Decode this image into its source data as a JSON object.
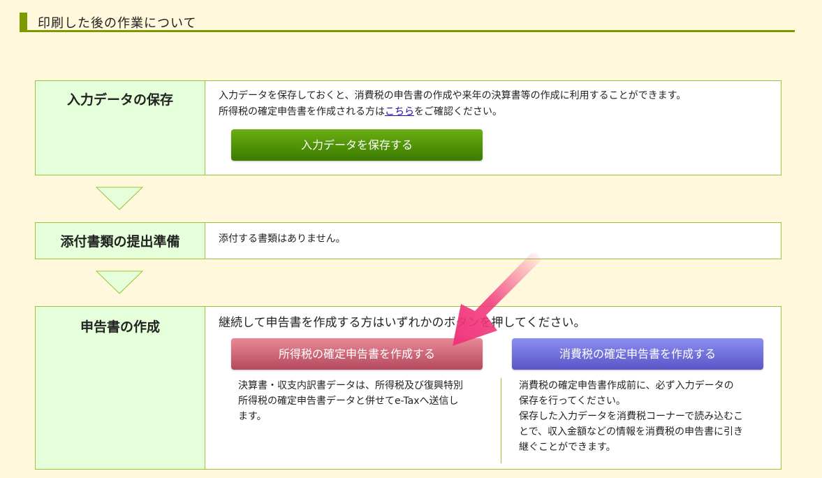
{
  "header": {
    "title": "印刷した後の作業について"
  },
  "step_save": {
    "label": "入力データの保存",
    "line1": "入力データを保存しておくと、消費税の申告書の作成や来年の決算書等の作成に利用することができます。",
    "line2_pre": "所得税の確定申告書を作成される方は",
    "line2_link": "こちら",
    "line2_post": "をご確認ください。",
    "button": "入力データを保存する"
  },
  "step_attach": {
    "label": "添付書類の提出準備",
    "text": "添付する書類はありません。"
  },
  "step_create": {
    "label": "申告書の作成",
    "intro": "継続して申告書を作成する方はいずれかのボタンを押してください。",
    "income_button": "所得税の確定申告書を作成する",
    "income_desc": [
      "決算書・収支内訳書データは、所得税及び復興特別",
      "所得税の確定申告書データと併せてe-Taxへ送信し",
      "ます。"
    ],
    "consumption_button": "消費税の確定申告書を作成する",
    "consumption_desc": [
      "消費税の確定申告書作成前に、必ず入力データの",
      "保存を行ってください。",
      "保存した入力データを消費税コーナーで読み込むこ",
      "とで、収入金額などの情報を消費税の申告書に引き",
      "継ぐことができます。"
    ]
  },
  "colors": {
    "accent": "#7a9a00",
    "label_bg": "#e4ffd9",
    "border": "#9bc438",
    "save_button": "#4f9400",
    "income_button": "#c85a6c",
    "consumption_button": "#6d6ddc",
    "pointer_arrow": "#f0357a"
  },
  "icons": [
    "down-triangle-icon",
    "pointer-arrow-icon"
  ]
}
